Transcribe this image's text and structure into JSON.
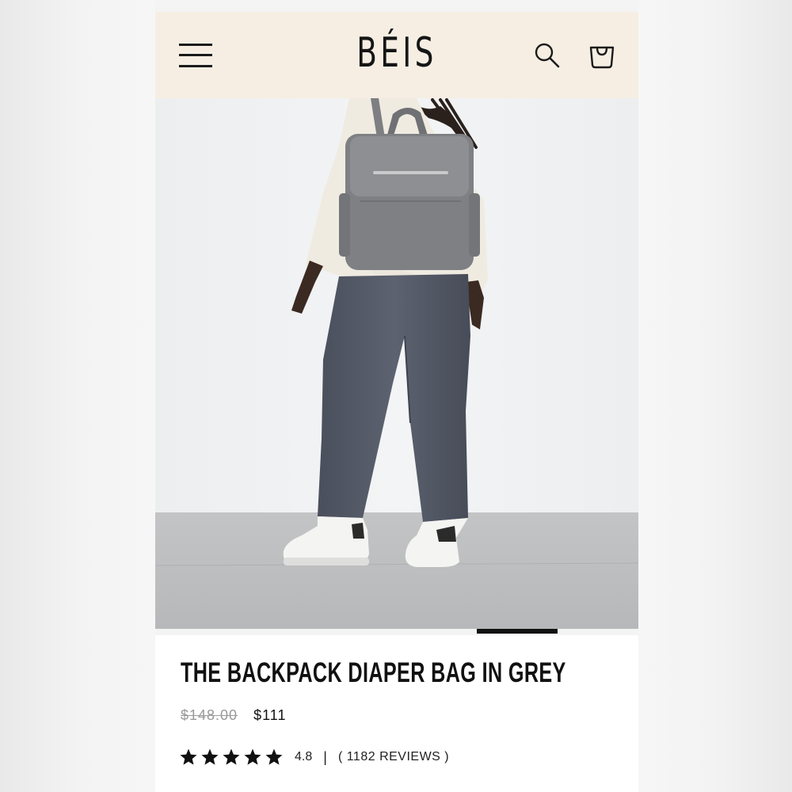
{
  "header": {
    "logo": "BÉIS",
    "menu_icon": "hamburger-menu-icon",
    "search_icon": "search-icon",
    "cart_icon": "shopping-bag-icon",
    "background_color": "#f6eee3"
  },
  "hero": {
    "image_description_icon": "product-photo",
    "carousel_active_index": 3
  },
  "product": {
    "title": "THE BACKPACK DIAPER BAG IN GREY",
    "original_price": "$148.00",
    "sale_price": "$111",
    "rating": "4.8",
    "rating_separator": "|",
    "reviews": "( 1182 REVIEWS )",
    "stars_filled": 5
  }
}
